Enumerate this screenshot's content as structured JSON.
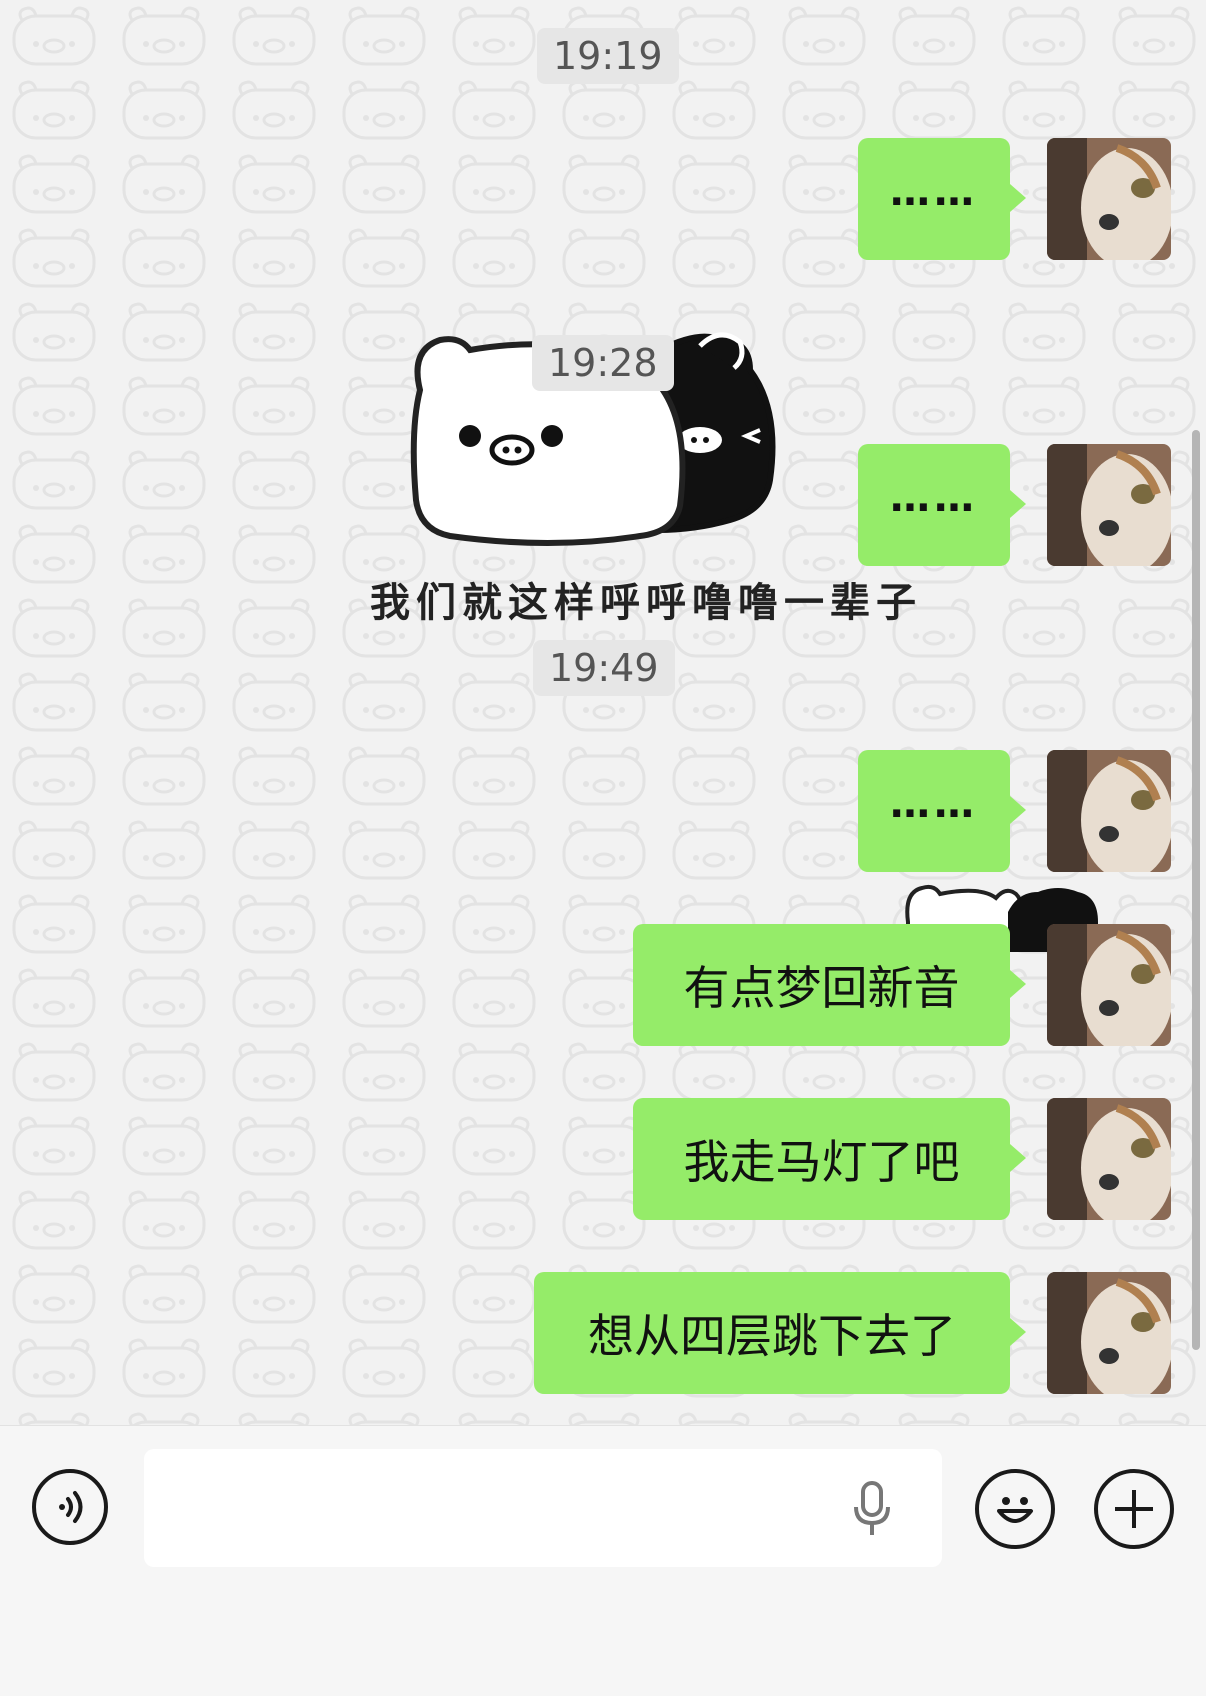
{
  "timestamps": [
    "19:19",
    "19:28",
    "19:49"
  ],
  "messages": [
    {
      "text": "……",
      "type": "dots"
    },
    {
      "text": "……",
      "type": "dots"
    },
    {
      "text": "……",
      "type": "dots"
    },
    {
      "text": "有点梦回新音",
      "type": "text"
    },
    {
      "text": "我走马灯了吧",
      "type": "text"
    },
    {
      "text": "想从四层跳下去了",
      "type": "text"
    }
  ],
  "sticker": {
    "caption": "我们就这样呼呼噜噜一辈子",
    "icon": "pig-pair-sticker"
  },
  "input": {
    "placeholder": "",
    "value": ""
  },
  "icons": {
    "voice": "voice-icon",
    "mic": "microphone-icon",
    "emoji": "emoji-icon",
    "plus": "plus-icon"
  },
  "colors": {
    "bubble": "#95ec69",
    "background": "#f2f2f2"
  }
}
